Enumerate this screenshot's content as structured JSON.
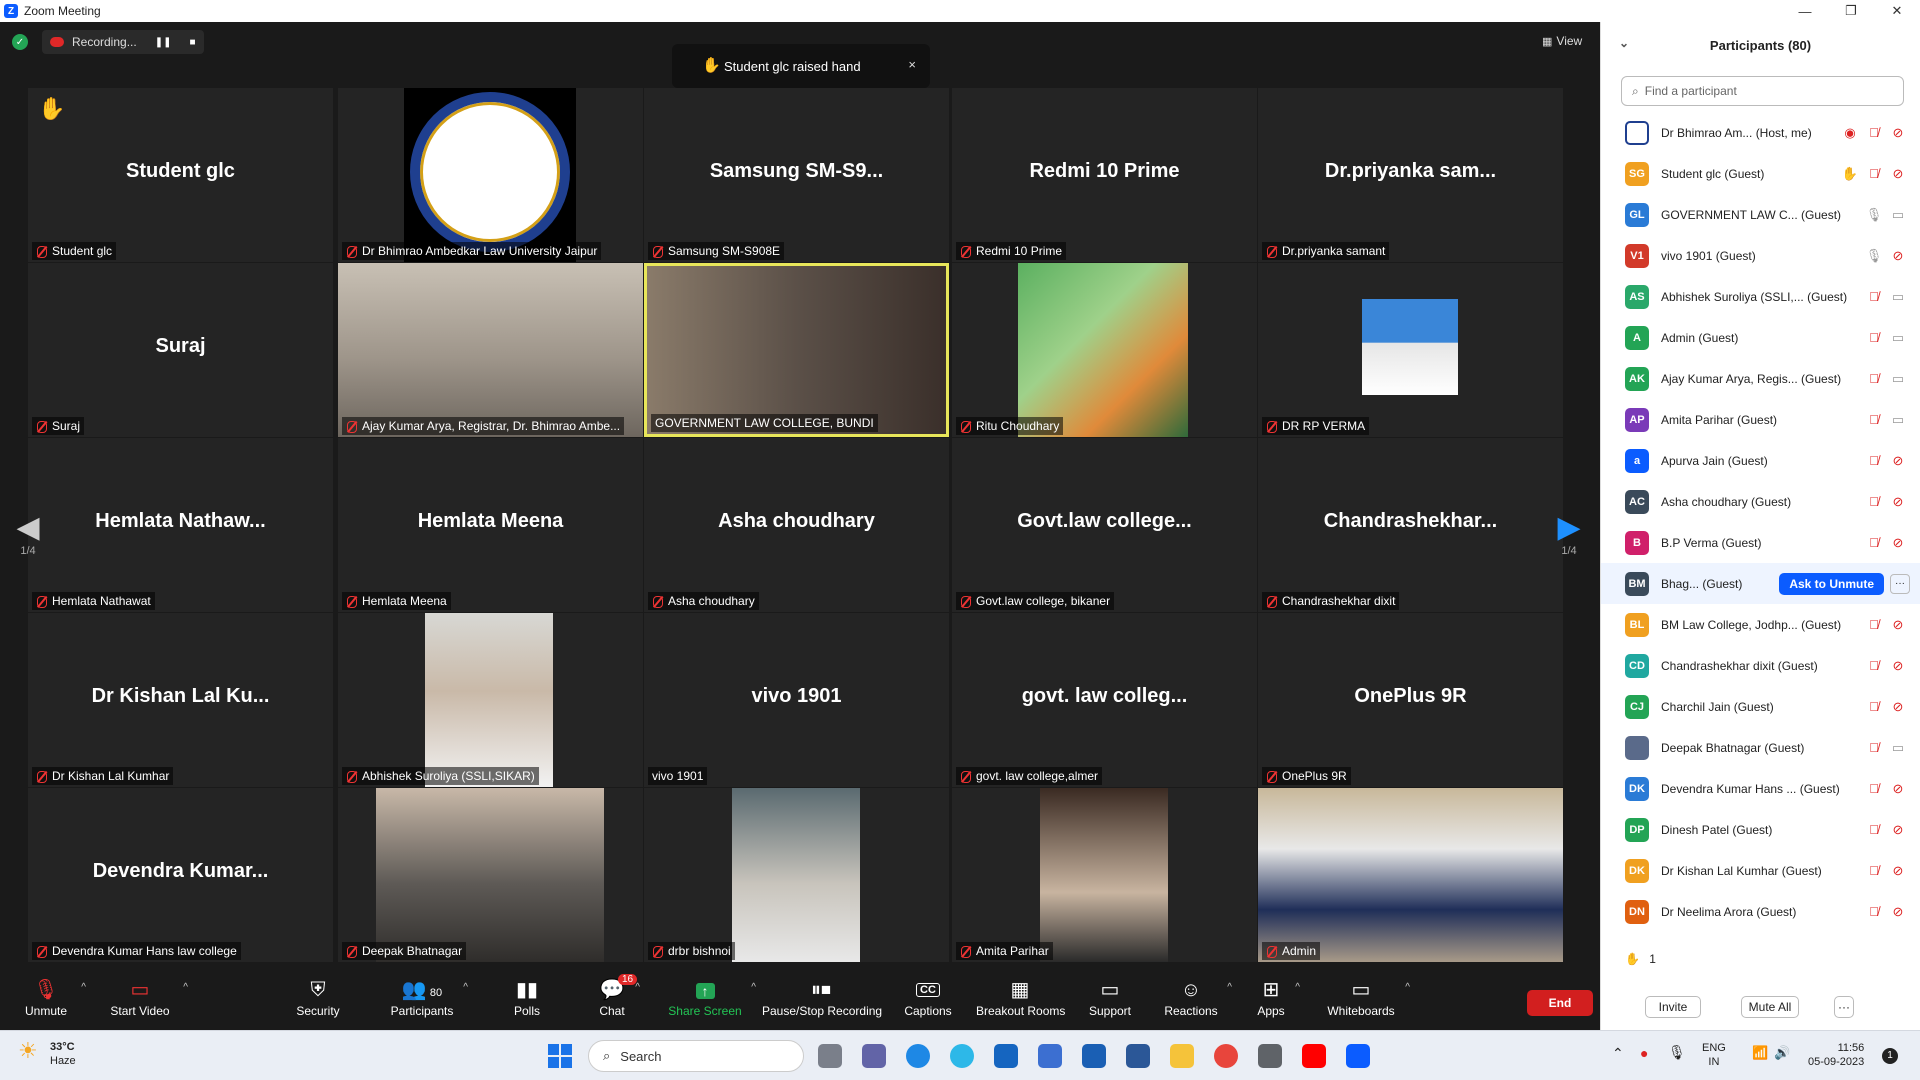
{
  "window": {
    "title": "Zoom Meeting"
  },
  "recording": {
    "label": "Recording...",
    "pause_icon": "pause-icon",
    "stop_icon": "stop-icon"
  },
  "toast": {
    "text": "Student glc raised hand",
    "close": "×"
  },
  "view": {
    "label": "View"
  },
  "pager": {
    "left": "1/4",
    "right": "1/4"
  },
  "tiles": [
    {
      "big": "Student glc",
      "name": "Student glc",
      "muted": true,
      "hand": true
    },
    {
      "big": "",
      "name": "Dr Bhimrao Ambedkar Law University Jaipur",
      "muted": true,
      "logo": true
    },
    {
      "big": "Samsung  SM-S9...",
      "name": "Samsung SM-S908E",
      "muted": true
    },
    {
      "big": "Redmi 10 Prime",
      "name": "Redmi 10 Prime",
      "muted": true
    },
    {
      "big": "Dr.priyanka  sam...",
      "name": "Dr.priyanka samant",
      "muted": true
    },
    {
      "big": "Suraj",
      "name": "Suraj",
      "muted": true
    },
    {
      "big": "",
      "name": "Ajay Kumar Arya, Registrar, Dr. Bhimrao Ambe...",
      "muted": true,
      "photo": "office"
    },
    {
      "big": "",
      "name": "GOVERNMENT LAW COLLEGE, BUNDI",
      "muted": false,
      "photo": "video",
      "active": true
    },
    {
      "big": "",
      "name": "Ritu Choudhary",
      "muted": true,
      "photo": "art"
    },
    {
      "big": "",
      "name": "DR RP VERMA",
      "muted": true,
      "photo": "portrait"
    },
    {
      "big": "Hemlata  Nathaw...",
      "name": "Hemlata Nathawat",
      "muted": true
    },
    {
      "big": "Hemlata Meena",
      "name": "Hemlata Meena",
      "muted": true
    },
    {
      "big": "Asha choudhary",
      "name": "Asha choudhary",
      "muted": true
    },
    {
      "big": "Govt.law  college...",
      "name": "Govt.law college, bikaner",
      "muted": true
    },
    {
      "big": "Chandrashekhar...",
      "name": "Chandrashekhar dixit",
      "muted": true
    },
    {
      "big": "Dr Kishan Lal Ku...",
      "name": "Dr Kishan Lal Kumhar",
      "muted": true
    },
    {
      "big": "",
      "name": "Abhishek Suroliya (SSLI,SIKAR)",
      "muted": true,
      "photo": "man"
    },
    {
      "big": "vivo 1901",
      "name": "vivo 1901",
      "muted": false
    },
    {
      "big": "govt.  law  colleg...",
      "name": "govt. law college,almer",
      "muted": true
    },
    {
      "big": "OnePlus 9R",
      "name": "OnePlus 9R",
      "muted": true
    },
    {
      "big": "Devendra  Kumar...",
      "name": "Devendra Kumar Hans law college",
      "muted": true
    },
    {
      "big": "",
      "name": "Deepak Bhatnagar",
      "muted": true,
      "photo": "car"
    },
    {
      "big": "",
      "name": "drbr bishnoi",
      "muted": true,
      "photo": "man2"
    },
    {
      "big": "",
      "name": "Amita Parihar",
      "muted": true,
      "photo": "woman"
    },
    {
      "big": "",
      "name": "Admin",
      "muted": true,
      "photo": "room"
    }
  ],
  "toolbar": {
    "unmute": "Unmute",
    "start_video": "Start Video",
    "security": "Security",
    "participants": "Participants",
    "participants_count": "80",
    "polls": "Polls",
    "chat": "Chat",
    "chat_badge": "16",
    "share": "Share Screen",
    "record": "Pause/Stop Recording",
    "captions": "Captions",
    "captions_icon": "CC",
    "breakout": "Breakout Rooms",
    "support": "Support",
    "reactions": "Reactions",
    "apps": "Apps",
    "whiteboards": "Whiteboards",
    "end": "End"
  },
  "panel": {
    "title": "Participants (80)",
    "search_placeholder": "Find a participant",
    "participants": [
      {
        "initials": "",
        "name": "Dr Bhimrao Am...  (Host, me)",
        "color": "#ffffff",
        "icons": [
          "rec",
          "mic-off",
          "vid-off"
        ]
      },
      {
        "initials": "SG",
        "name": "Student glc (Guest)",
        "color": "#f0a020",
        "icons": [
          "hand",
          "mic-off",
          "vid-off"
        ]
      },
      {
        "initials": "GL",
        "name": "GOVERNMENT LAW C...  (Guest)",
        "color": "#2a7bd6",
        "icons": [
          "mic",
          "vid"
        ]
      },
      {
        "initials": "V1",
        "name": "vivo 1901 (Guest)",
        "color": "#d23a2a",
        "icons": [
          "mic",
          "vid-off"
        ]
      },
      {
        "initials": "AS",
        "name": "Abhishek Suroliya (SSLI,...  (Guest)",
        "color": "#2aa86a",
        "icons": [
          "mic-off",
          "vid"
        ]
      },
      {
        "initials": "A",
        "name": "Admin (Guest)",
        "color": "#23a455",
        "icons": [
          "mic-off",
          "vid"
        ]
      },
      {
        "initials": "AK",
        "name": "Ajay Kumar Arya, Regis...  (Guest)",
        "color": "#23a455",
        "icons": [
          "mic-off",
          "vid"
        ]
      },
      {
        "initials": "AP",
        "name": "Amita Parihar (Guest)",
        "color": "#7a3ab8",
        "icons": [
          "mic-off",
          "vid"
        ]
      },
      {
        "initials": "a",
        "name": "Apurva Jain (Guest)",
        "color": "#0b5cff",
        "icons": [
          "mic-off",
          "vid-off"
        ]
      },
      {
        "initials": "AC",
        "name": "Asha choudhary (Guest)",
        "color": "#3a4a5a",
        "icons": [
          "mic-off",
          "vid-off"
        ]
      },
      {
        "initials": "B",
        "name": "B.P Verma (Guest)",
        "color": "#d0206a",
        "icons": [
          "mic-off",
          "vid-off"
        ]
      },
      {
        "initials": "BM",
        "name": "Bhag...  (Guest)",
        "color": "#3a4a5a",
        "icons": [],
        "ask": "Ask to Unmute",
        "more": "···"
      },
      {
        "initials": "BL",
        "name": "BM Law College, Jodhp...  (Guest)",
        "color": "#f0a020",
        "icons": [
          "mic-off",
          "vid-off"
        ]
      },
      {
        "initials": "CD",
        "name": "Chandrashekhar dixit (Guest)",
        "color": "#20a8a0",
        "icons": [
          "mic-off",
          "vid-off"
        ]
      },
      {
        "initials": "CJ",
        "name": "Charchil Jain (Guest)",
        "color": "#23a455",
        "icons": [
          "mic-off",
          "vid-off"
        ]
      },
      {
        "initials": "",
        "name": "Deepak Bhatnagar (Guest)",
        "color": "#5a6a8a",
        "icons": [
          "mic-off",
          "vid"
        ]
      },
      {
        "initials": "DK",
        "name": "Devendra Kumar Hans ...  (Guest)",
        "color": "#2a7bd6",
        "icons": [
          "mic-off",
          "vid-off"
        ]
      },
      {
        "initials": "DP",
        "name": "Dinesh Patel (Guest)",
        "color": "#23a455",
        "icons": [
          "mic-off",
          "vid-off"
        ]
      },
      {
        "initials": "DK",
        "name": "Dr Kishan Lal Kumhar (Guest)",
        "color": "#f0a020",
        "icons": [
          "mic-off",
          "vid-off"
        ]
      },
      {
        "initials": "DN",
        "name": "Dr Neelima Arora (Guest)",
        "color": "#e06010",
        "icons": [
          "mic-off",
          "vid-off"
        ]
      }
    ],
    "raised_count": "1",
    "invite": "Invite",
    "mute_all": "Mute All",
    "more": "···"
  },
  "taskbar": {
    "temp": "33°C",
    "weather": "Haze",
    "search": "Search",
    "lang": "ENG",
    "region": "IN",
    "time": "11:56",
    "date": "05-09-2023",
    "notif": "1"
  }
}
